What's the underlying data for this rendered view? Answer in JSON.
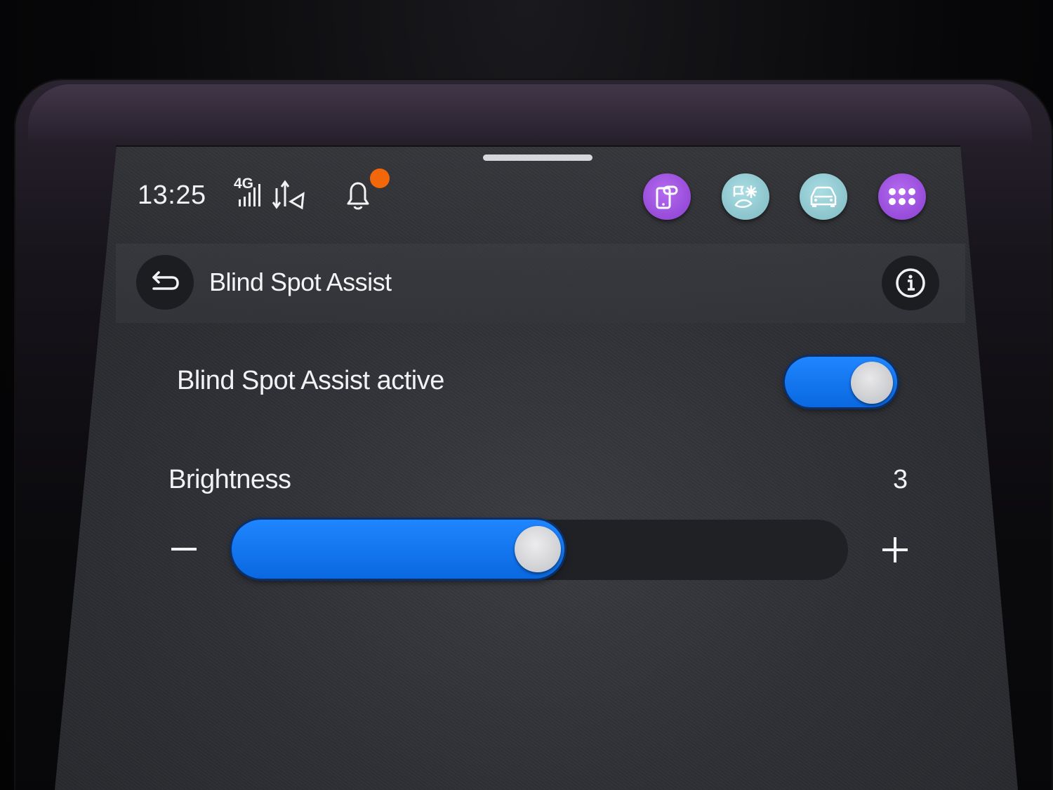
{
  "status_bar": {
    "time": "13:25",
    "network": "4G",
    "icons": [
      "signal-bars-icon",
      "data-transfer-icon",
      "notification-bell-icon"
    ],
    "notification_dot_color": "#f2670a"
  },
  "quick_apps": [
    {
      "name": "phone-link-app",
      "icon": "phone-link-icon",
      "color": "#a257e6"
    },
    {
      "name": "climate-app",
      "icon": "climate-icon",
      "color": "#8ccbd3"
    },
    {
      "name": "vehicle-app",
      "icon": "car-icon",
      "color": "#8ccbd3"
    },
    {
      "name": "all-apps",
      "icon": "apps-grid-icon",
      "color": "#a257e6"
    }
  ],
  "header": {
    "title": "Blind Spot Assist",
    "back_icon": "back-arrow-icon",
    "info_icon": "info-icon"
  },
  "settings": {
    "toggle": {
      "label": "Blind Spot Assist active",
      "enabled": true
    },
    "brightness": {
      "label": "Brightness",
      "value": "3",
      "level_fraction": 0.54
    }
  },
  "colors": {
    "accent": "#0a74f5",
    "screen_bg": "#2e2f34",
    "text": "#f2f2f4"
  }
}
